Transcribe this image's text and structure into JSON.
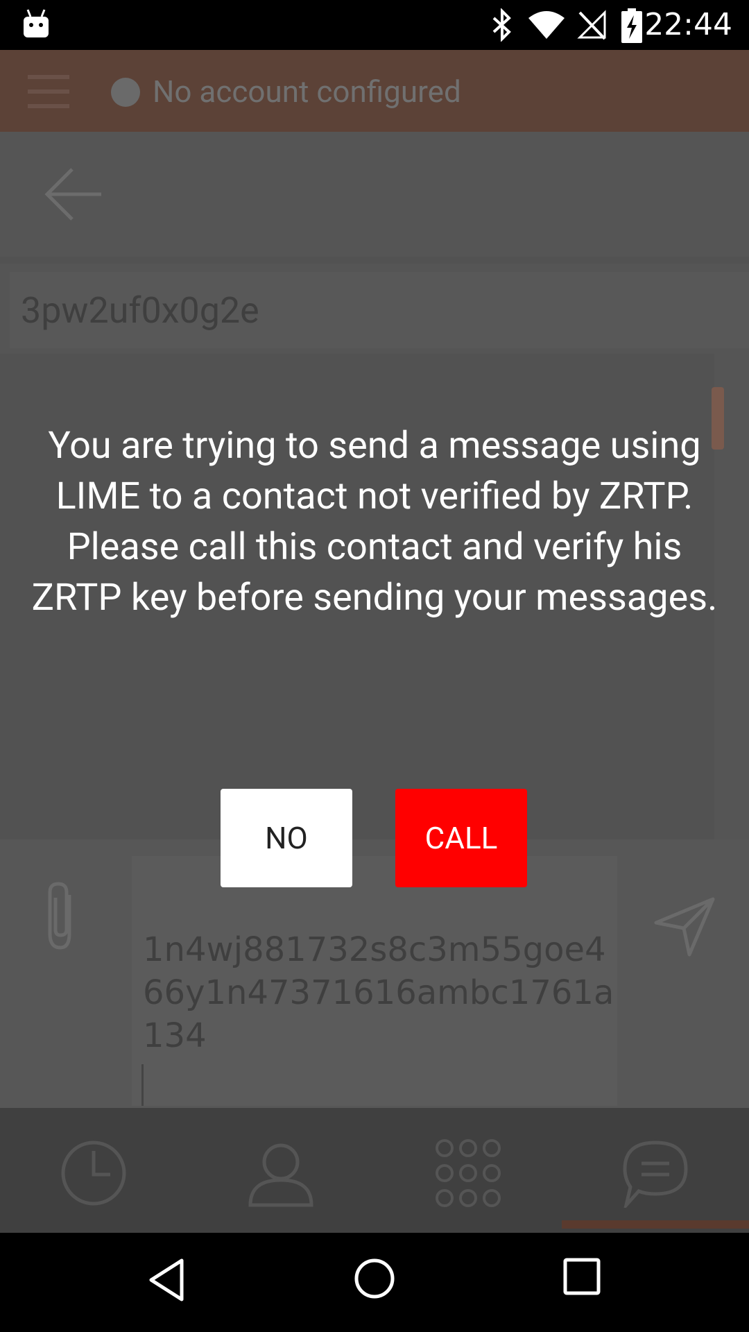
{
  "status_bar": {
    "time": "22:44",
    "icons": [
      "android-debug-icon",
      "bluetooth-icon",
      "wifi-icon",
      "no-signal-icon",
      "battery-charging-icon"
    ]
  },
  "toolbar": {
    "menu_icon": "hamburger-menu-icon",
    "account_status": "No account configured"
  },
  "chat": {
    "contact": "3pw2uf0x0g2e",
    "compose_text": "1n4wj881732s8c3m55goe466y1n47371616ambc1761a134"
  },
  "dialog": {
    "message": "You are trying to send a message using LIME to a contact not verified by ZRTP.\nPlease call this contact and verify his ZRTP key before sending your messages.",
    "no_label": "NO",
    "call_label": "CALL"
  },
  "tabs": [
    {
      "icon": "history-clock-icon"
    },
    {
      "icon": "contacts-person-icon"
    },
    {
      "icon": "dialer-keypad-icon"
    },
    {
      "icon": "chat-bubble-icon"
    }
  ],
  "colors": {
    "call_button": "#ff0000",
    "no_button": "#ffffff",
    "toolbar_dimmed": "#5c4237"
  }
}
